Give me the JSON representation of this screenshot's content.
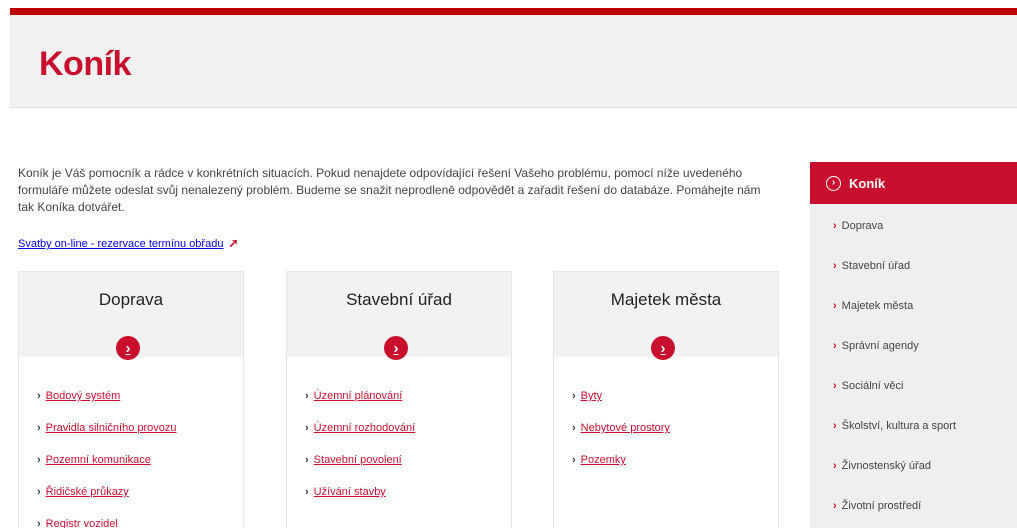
{
  "header": {
    "title": "Koník"
  },
  "intro": {
    "text": "Koník je Váš pomocník a rádce v konkrétních situacích. Pokud nenajdete odpovídající řešení Vašeho problému, pomocí níže uvedeného formuláře můžete odeslat svůj nenalezený problém. Budeme se snažit neprodleně odpovědět a zařadit řešení do databáze. Pomáhejte nám tak Koníka dotvářet."
  },
  "svatby": {
    "label": "Svatby on-line - rezervace termínu obřadu",
    "icon": "external-link-icon"
  },
  "cards": [
    {
      "title": "Doprava",
      "items": [
        "Bodový systém",
        "Pravidla silničního provozu",
        "Pozemní komunikace",
        "Řidičské průkazy",
        "Registr vozidel"
      ]
    },
    {
      "title": "Stavební úřad",
      "items": [
        "Územní plánování",
        "Územní rozhodování",
        "Stavební povolení",
        "Užívání stavby"
      ]
    },
    {
      "title": "Majetek města",
      "items": [
        "Byty",
        "Nebytové prostory",
        "Pozemky"
      ]
    }
  ],
  "sidebar": {
    "title": "Koník",
    "items": [
      "Doprava",
      "Stavební úřad",
      "Majetek města",
      "Správní agendy",
      "Sociální věci",
      "Školství, kultura a sport",
      "Živnostenský úřad",
      "Životní prostředí"
    ]
  },
  "colors": {
    "brand": "#c8102e",
    "header_bg": "#f1f1f1",
    "card_head_bg": "#f2f2f2",
    "sidebar_bg": "#efefef"
  }
}
